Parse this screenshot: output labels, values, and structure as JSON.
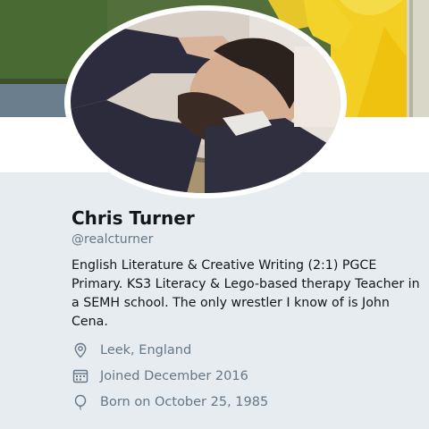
{
  "profile": {
    "name": "Chris Turner",
    "handle": "@realcturner",
    "bio": "English Literature & Creative Writing (2:1) PGCE Primary. KS3 Literacy & Lego-based therapy Teacher in a SEMH school. The only wrestler I know of is John Cena.",
    "location": "Leek, England",
    "joined": "Joined December 2016",
    "birthday": "Born on October 25, 1985"
  },
  "icons": {
    "location": "location-pin-icon",
    "joined": "calendar-icon",
    "birthday": "balloon-icon"
  },
  "colors": {
    "background": "#e6ecf0",
    "text_primary": "#14171a",
    "text_secondary": "#657786"
  }
}
